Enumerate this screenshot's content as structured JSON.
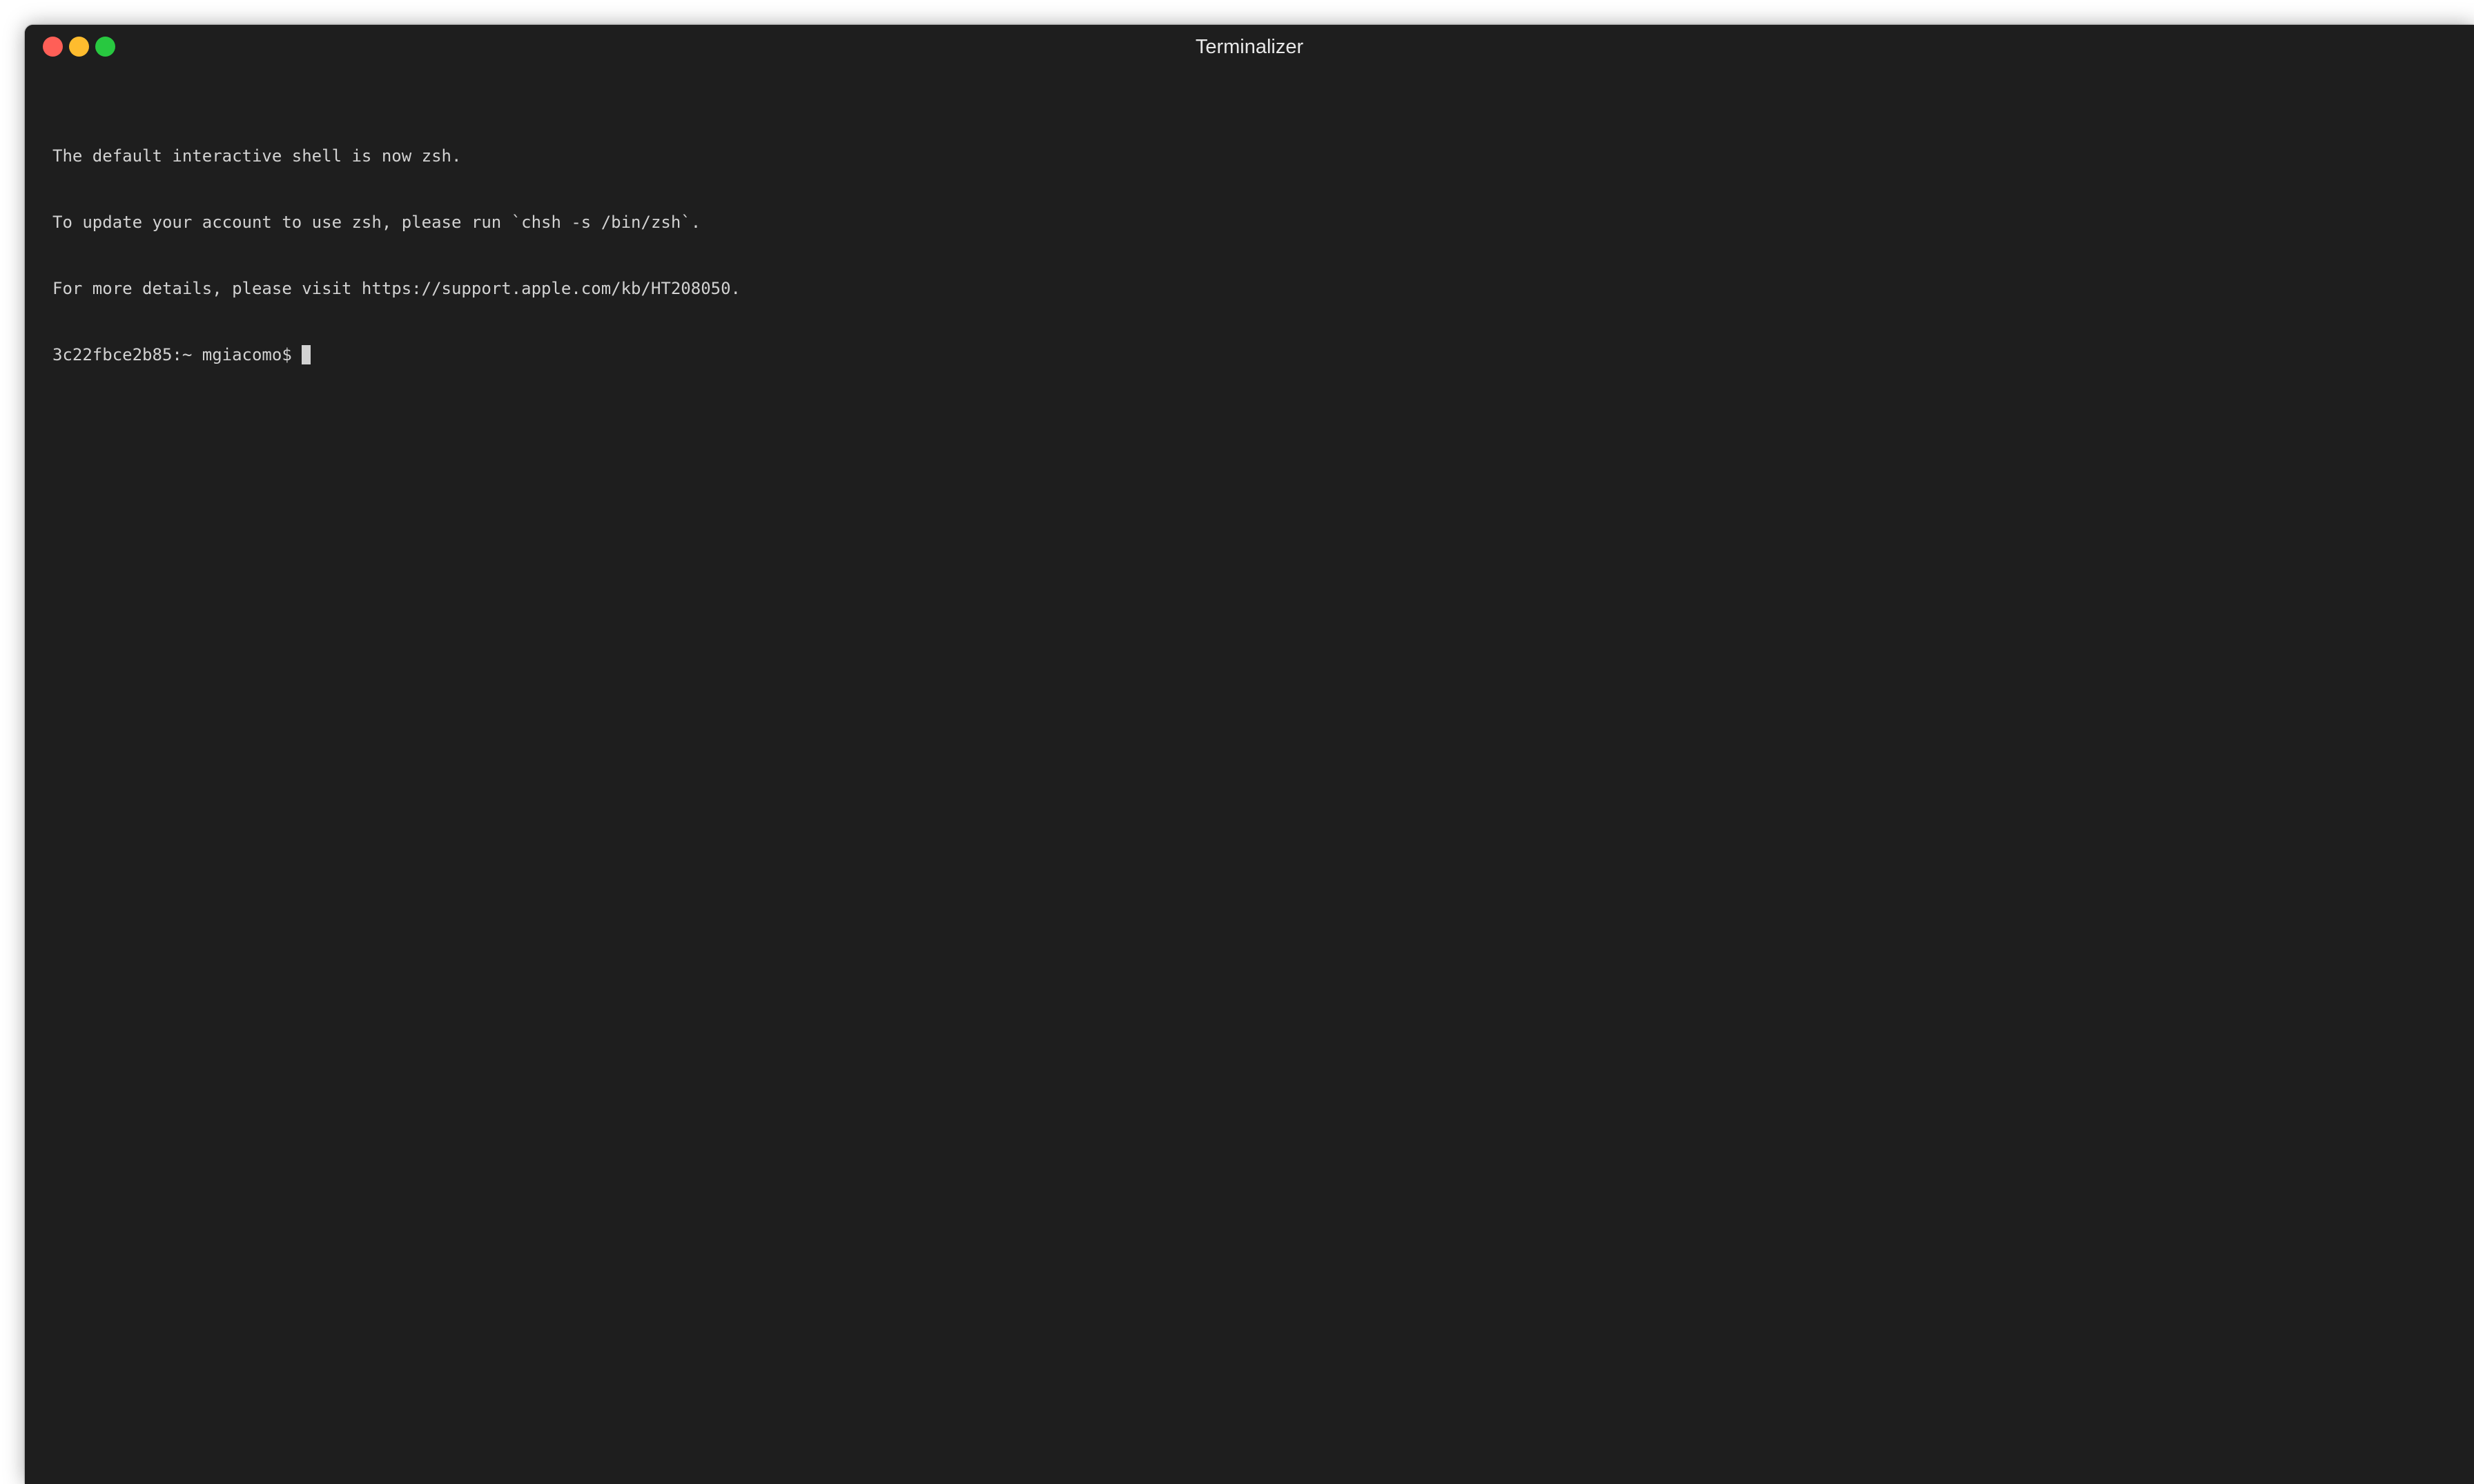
{
  "window": {
    "title": "Terminalizer"
  },
  "controls": {
    "close_color": "#ff5f57",
    "minimize_color": "#febc2e",
    "maximize_color": "#28c840"
  },
  "terminal": {
    "lines": [
      "The default interactive shell is now zsh.",
      "To update your account to use zsh, please run `chsh -s /bin/zsh`.",
      "For more details, please visit https://support.apple.com/kb/HT208050."
    ],
    "prompt": "3c22fbce2b85:~ mgiacomo$"
  },
  "colors": {
    "background": "#1e1e1e",
    "text": "#d2d2d2"
  }
}
